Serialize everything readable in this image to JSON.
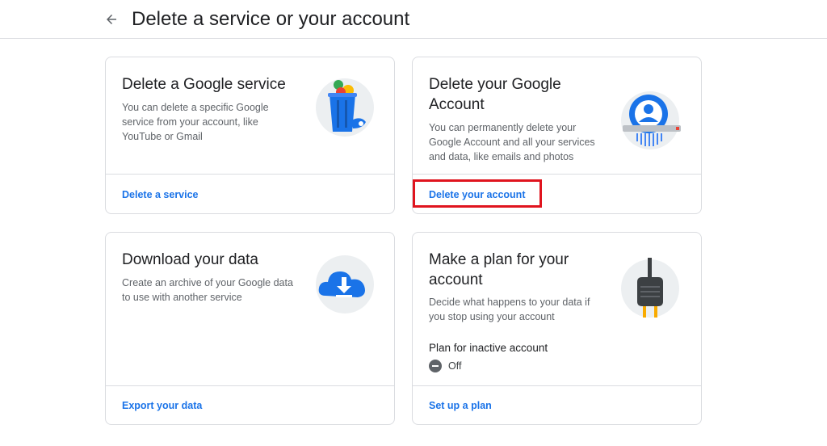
{
  "header": {
    "title": "Delete a service or your account",
    "back_icon": "arrow-back-icon"
  },
  "cards": [
    {
      "title": "Delete a Google service",
      "description": "You can delete a specific Google service from your account, like YouTube or Gmail",
      "link": "Delete a service",
      "illustration": "trash-can-icon"
    },
    {
      "title": "Delete your Google Account",
      "description": "You can permanently delete your Google Account and all your services and data, like emails and photos",
      "link": "Delete your account",
      "illustration": "account-shredder-icon"
    },
    {
      "title": "Download your data",
      "description": "Create an archive of your Google data to use with another service",
      "link": "Export your data",
      "illustration": "cloud-download-icon"
    },
    {
      "title": "Make a plan for your account",
      "description": "Decide what happens to your data if you stop using your account",
      "inactive_label": "Plan for inactive account",
      "inactive_status": "Off",
      "link": "Set up a plan",
      "illustration": "power-plug-icon"
    }
  ],
  "colors": {
    "link": "#1a73e8",
    "highlight": "#e0141e",
    "border": "#dadce0"
  }
}
